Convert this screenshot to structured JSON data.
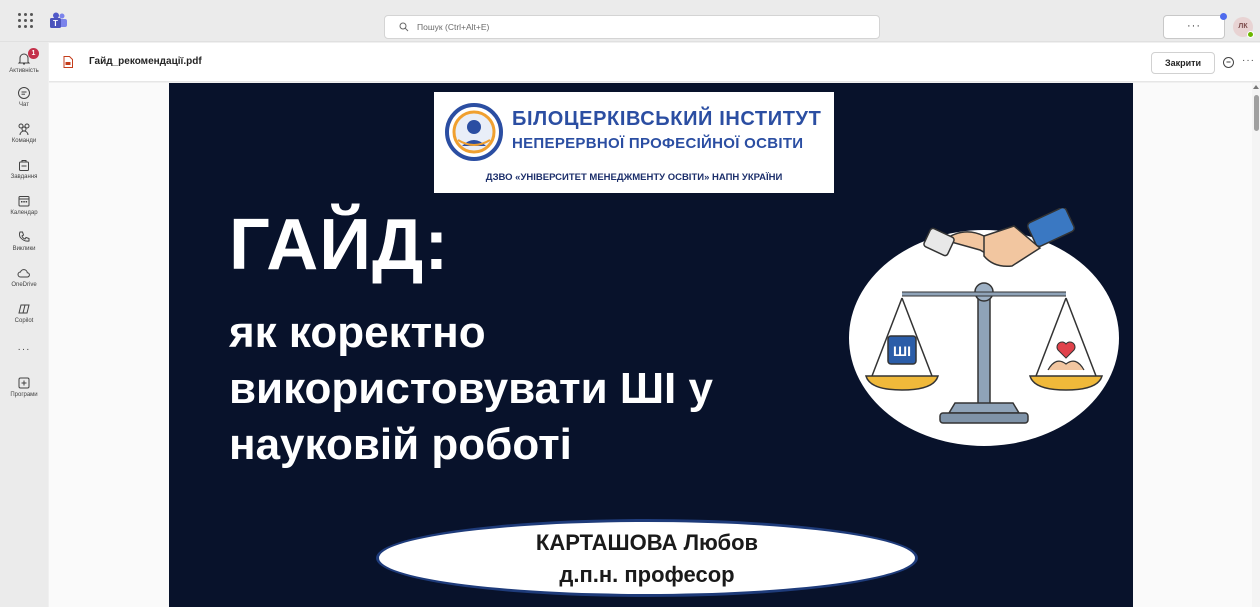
{
  "topbar": {
    "search_placeholder": "Пошук (Ctrl+Alt+E)",
    "more_label": "···",
    "avatar_initials": "ЛК"
  },
  "rail": {
    "items": [
      {
        "label": "Активність",
        "icon": "bell-icon",
        "badge": "1"
      },
      {
        "label": "Чат",
        "icon": "chat-icon"
      },
      {
        "label": "Команди",
        "icon": "teams-icon"
      },
      {
        "label": "Завдання",
        "icon": "assignments-icon"
      },
      {
        "label": "Календар",
        "icon": "calendar-icon"
      },
      {
        "label": "Виклики",
        "icon": "phone-icon"
      },
      {
        "label": "OneDrive",
        "icon": "cloud-icon"
      },
      {
        "label": "Copilot",
        "icon": "copilot-icon"
      },
      {
        "label": "···",
        "icon": "more-icon"
      },
      {
        "label": "Програми",
        "icon": "add-apps-icon"
      }
    ]
  },
  "document": {
    "file_name": "Гайд_рекомендації.pdf",
    "close_label": "Закрити",
    "more_label": "···"
  },
  "pdf": {
    "institute_line1": "БІЛОЦЕРКІВСЬКИЙ ІНСТИТУТ",
    "institute_line2": "НЕПЕРЕРВНОЇ ПРОФЕСІЙНОЇ ОСВІТИ",
    "institute_line3": "ДЗВО «УНІВЕРСИТЕТ МЕНЕДЖМЕНТУ ОСВІТИ» НАПН УКРАЇНИ",
    "title": "ГАЙД:",
    "subtitle_lines": [
      "як коректно",
      "використовувати ШІ у",
      "науковій роботі"
    ],
    "scale_label": "ШІ",
    "author_name": "КАРТАШОВА Любов",
    "author_degree": "д.п.н. професор"
  },
  "colors": {
    "page_background": "#08122b",
    "brand_blue": "#2b4ea2",
    "badge_red": "#c4314b",
    "presence_green": "#6bb700"
  }
}
